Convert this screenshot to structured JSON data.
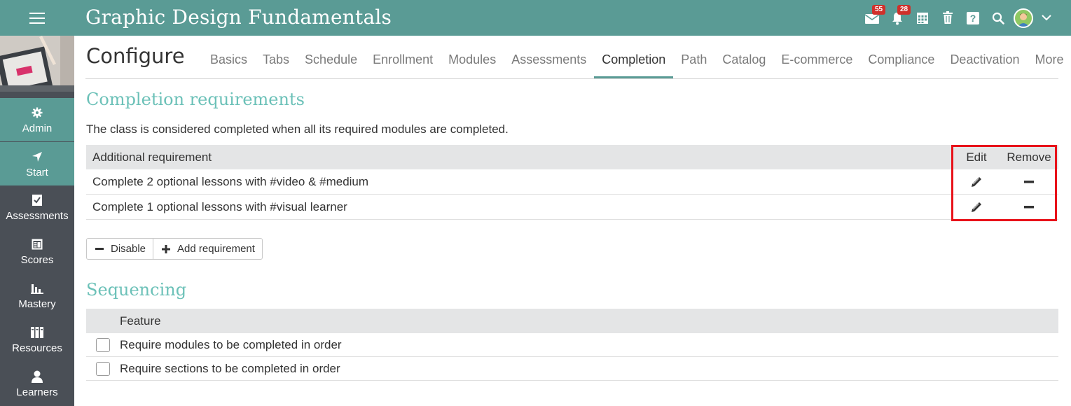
{
  "header": {
    "title": "Graphic Design Fundamentals",
    "messages_badge": "55",
    "notifications_badge": "28"
  },
  "sidebar": {
    "items": [
      {
        "label": "Admin",
        "icon": "gear-icon"
      },
      {
        "label": "Start",
        "icon": "navigation-arrow-icon"
      },
      {
        "label": "Assessments",
        "icon": "checklist-icon"
      },
      {
        "label": "Scores",
        "icon": "gradebook-icon"
      },
      {
        "label": "Mastery",
        "icon": "bar-chart-icon"
      },
      {
        "label": "Resources",
        "icon": "books-icon"
      },
      {
        "label": "Learners",
        "icon": "person-icon"
      }
    ]
  },
  "page": {
    "title": "Configure",
    "tabs": [
      "Basics",
      "Tabs",
      "Schedule",
      "Enrollment",
      "Modules",
      "Assessments",
      "Completion",
      "Path",
      "Catalog",
      "E-commerce",
      "Compliance",
      "Deactivation",
      "More"
    ],
    "active_tab": "Completion"
  },
  "completion": {
    "title": "Completion requirements",
    "description": "The class is considered completed when all its required modules are completed.",
    "columns": {
      "requirement": "Additional requirement",
      "edit": "Edit",
      "remove": "Remove"
    },
    "rows": [
      "Complete 2 optional lessons with #video & #medium",
      "Complete 1 optional lessons with #visual learner"
    ],
    "buttons": {
      "disable": "Disable",
      "add": "Add requirement"
    }
  },
  "sequencing": {
    "title": "Sequencing",
    "column": "Feature",
    "rows": [
      {
        "label": "Require modules to be completed in order",
        "checked": false
      },
      {
        "label": "Require sections to be completed in order",
        "checked": false
      }
    ]
  },
  "colors": {
    "brand": "#5a9b95",
    "section_title": "#6cc1b8",
    "sidebar": "#4a4f56",
    "highlight": "#e8121a",
    "badge": "#d0302b"
  }
}
